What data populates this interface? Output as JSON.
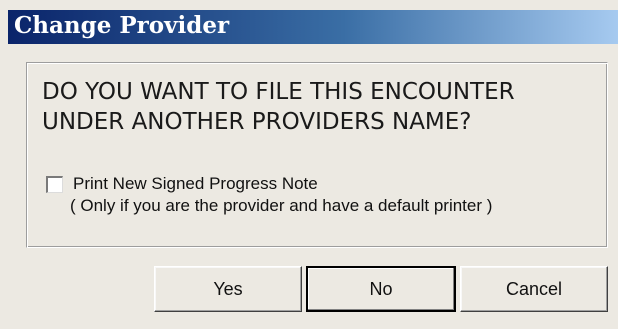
{
  "window": {
    "title": "Change Provider"
  },
  "message": {
    "question": "DO YOU WANT TO FILE THIS ENCOUNTER\nUNDER ANOTHER PROVIDERS NAME?"
  },
  "option": {
    "checkbox_checked": false,
    "label": "Print New Signed Progress Note",
    "note": "( Only if you are the provider and have a default printer )"
  },
  "buttons": {
    "yes": "Yes",
    "no": "No",
    "cancel": "Cancel",
    "default": "no"
  },
  "colors": {
    "title_gradient_start": "#0a246a",
    "title_gradient_end": "#a6caf0",
    "dialog_background": "#ece9e2"
  }
}
